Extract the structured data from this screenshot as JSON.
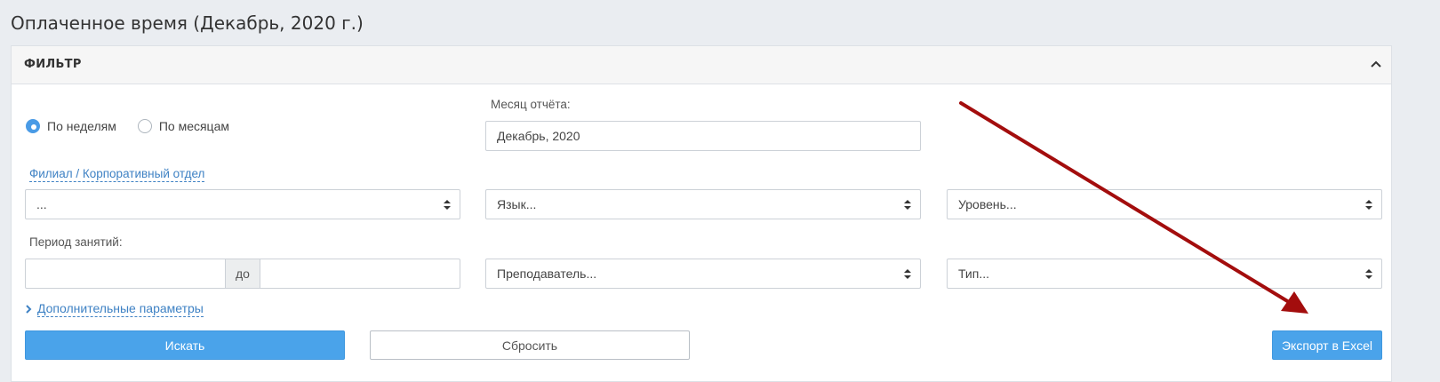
{
  "page": {
    "title": "Оплаченное время (Декабрь, 2020 г.)"
  },
  "filter": {
    "header_title": "ФИЛЬТР",
    "collapse_icon": "chevron-up-icon",
    "grouping": {
      "options": [
        {
          "label": "По неделям",
          "checked": true
        },
        {
          "label": "По месяцам",
          "checked": false
        }
      ]
    },
    "report_month": {
      "label": "Месяц отчёта:",
      "value": "Декабрь, 2020"
    },
    "branch": {
      "label": "Филиал / Корпоративный отдел",
      "value": "..."
    },
    "language": {
      "placeholder": "Язык..."
    },
    "level": {
      "placeholder": "Уровень..."
    },
    "period": {
      "label": "Период занятий:",
      "from_value": "",
      "to_addon": "до",
      "to_value": ""
    },
    "teacher": {
      "placeholder": "Преподаватель..."
    },
    "type": {
      "placeholder": "Тип..."
    },
    "advanced": {
      "label": "Дополнительные параметры"
    },
    "buttons": {
      "search": "Искать",
      "reset": "Сбросить",
      "export": "Экспорт в Excel"
    }
  },
  "colors": {
    "primary": "#4aa3ea",
    "link": "#3f82c4",
    "annotation_arrow": "#a30d0d"
  }
}
